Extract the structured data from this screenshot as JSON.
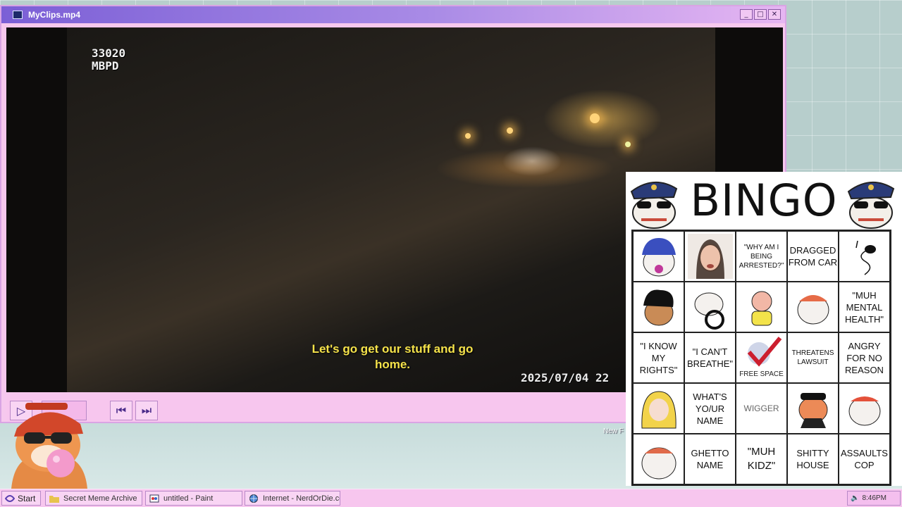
{
  "window": {
    "title": "MyClips.mp4",
    "controls": {
      "minimize": "_",
      "maximize": "□",
      "close": "✕"
    }
  },
  "video": {
    "overlay_line1": "33020",
    "overlay_line2": "MBPD",
    "caption_line1": "Let's go get our stuff and go",
    "caption_line2": "home.",
    "timestamp": "2025/07/04  22"
  },
  "player_controls": {
    "play": "▷",
    "previous": "⏮",
    "next": "⏭"
  },
  "desktop": {
    "partial_label": "New F"
  },
  "bingo": {
    "title": "BINGO",
    "cells": [
      "",
      "",
      "\"WHY AM I BEING ARRESTED?\"",
      "DRAGGED FROM CAR",
      "",
      "",
      "",
      "",
      "",
      "\"MUH MENTAL HEALTH\"",
      "\"I KNOW MY RIGHTS\"",
      "\"I CAN'T BREATHE\"",
      "",
      "THREATENS LAWSUIT",
      "ANGRY FOR NO REASON",
      "",
      "WHAT'S YO/UR NAME",
      "WIGGER",
      "",
      "",
      "",
      "GHETTO NAME",
      "\"MUH KIDZ\"",
      "SHITTY HOUSE",
      "ASSAULTS COP"
    ],
    "free_space_label": "FREE SPACE"
  },
  "taskbar": {
    "start_label": "Start",
    "tasks": [
      {
        "label": "Secret Meme Archive",
        "icon": "folder-icon"
      },
      {
        "label": "untitled - Paint",
        "icon": "paint-icon"
      },
      {
        "label": "Internet - NerdOrDie.com",
        "icon": "globe-icon"
      }
    ],
    "clock": "8:46PM"
  }
}
